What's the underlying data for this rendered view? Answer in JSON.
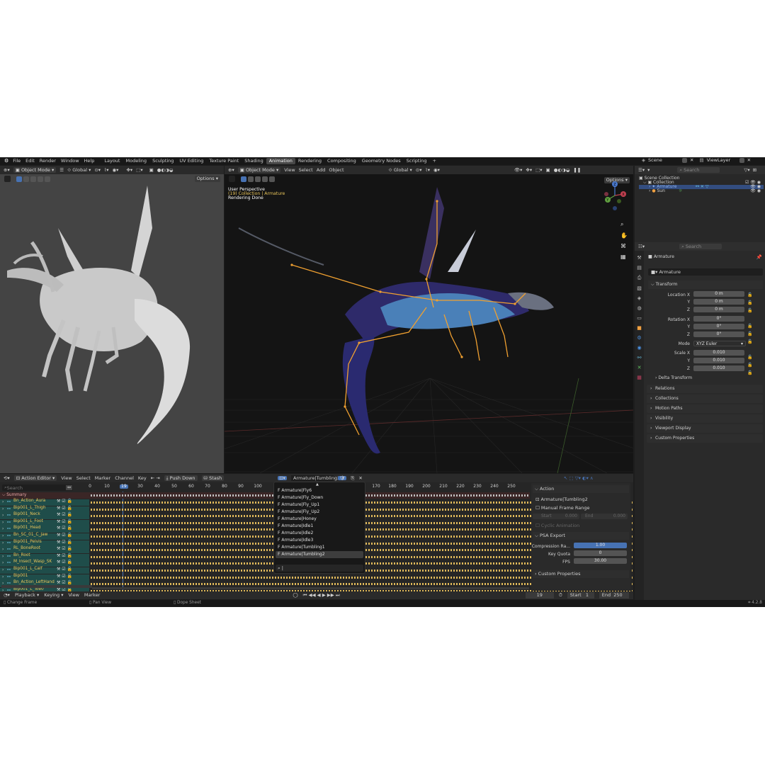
{
  "topbar": {
    "menus": [
      "File",
      "Edit",
      "Render",
      "Window",
      "Help"
    ],
    "workspaces": [
      "Layout",
      "Modeling",
      "Sculpting",
      "UV Editing",
      "Texture Paint",
      "Shading",
      "Animation",
      "Rendering",
      "Compositing",
      "Geometry Nodes",
      "Scripting"
    ],
    "active_workspace": "Animation",
    "add_tab": "+",
    "scene": "Scene",
    "view_layer": "ViewLayer"
  },
  "viewport_left": {
    "mode": "Object Mode",
    "orientation": "Global",
    "options": "Options"
  },
  "viewport_main": {
    "mode": "Object Mode",
    "menus": [
      "View",
      "Select",
      "Add",
      "Object"
    ],
    "orientation": "Global",
    "options": "Options",
    "info_line1": "User Perspective",
    "info_line2": "(19) Collection | Armature",
    "info_line3": "Rendering Done",
    "gizmo_axes": [
      "Z",
      "Y",
      "X"
    ]
  },
  "outliner": {
    "search_placeholder": "Search",
    "items": [
      {
        "label": "Scene Collection"
      },
      {
        "label": "Collection"
      },
      {
        "label": "Armature"
      },
      {
        "label": "Sun"
      }
    ]
  },
  "properties": {
    "search_placeholder": "Search",
    "object_name": "Armature",
    "name_field": "Armature",
    "transform_header": "Transform",
    "location_label": "Location X",
    "rotation_label": "Rotation X",
    "scale_label": "Scale X",
    "axis_y": "Y",
    "axis_z": "Z",
    "location": [
      "0 m",
      "0 m",
      "0 m"
    ],
    "rotation": [
      "0°",
      "0°",
      "0°"
    ],
    "mode_label": "Mode",
    "mode_value": "XYZ Euler",
    "scale": [
      "0.010",
      "0.010",
      "0.010"
    ],
    "sections": [
      "Delta Transform",
      "Relations",
      "Collections",
      "Motion Paths",
      "Visibility",
      "Viewport Display",
      "Custom Properties"
    ]
  },
  "action_editor": {
    "editor": "Action Editor",
    "menus": [
      "View",
      "Select",
      "Marker",
      "Channel",
      "Key"
    ],
    "push_down": "Push Down",
    "stash": "Stash",
    "action_name": "Armature|Tumbling2",
    "search_placeholder": "Search",
    "frame_ticks": [
      "0",
      "10",
      "19",
      "30",
      "40",
      "50",
      "60",
      "70",
      "80",
      "90",
      "100",
      "170",
      "180",
      "190",
      "200",
      "210",
      "220",
      "230",
      "240",
      "250"
    ],
    "current_frame_badge": "19",
    "summary": "Summary",
    "channels": [
      "Bn_Action_Aura",
      "Bip001_L_Thigh",
      "Bip001_Neck",
      "Bip001_L_Foot",
      "Bip001_Head",
      "Bn_SC_01_C_Jaw",
      "Bip001_Pelvis",
      "RL_BoneRoot",
      "Bn_Root",
      "M_Insect_Wasp_SK",
      "Bip001_L_Calf",
      "Bip001",
      "Bn_Action_LeftHand",
      "Bip001_L_Toe0"
    ],
    "action_list": [
      "Armature|Fly6",
      "Armature|Fly_Down",
      "Armature|Fly_Up1",
      "Armature|Fly_Up2",
      "Armature|Honey",
      "Armature|Idle1",
      "Armature|Idle2",
      "Armature|Idle3",
      "Armature|Tumbling1",
      "Armature|Tumbling2"
    ],
    "fake_user_prefix": "F"
  },
  "action_panel": {
    "header": "Action",
    "action": "Armature|Tumbling2",
    "manual_frame_range": "Manual Frame Range",
    "start_label": "Start",
    "start_value": "0.000",
    "end_label": "End",
    "end_value": "0.000",
    "cyclic": "Cyclic Animation",
    "psa_header": "PSA Export",
    "compression_label": "Compression Ra...",
    "compression_value": "1.00",
    "key_quota_label": "Key Quota",
    "key_quota_value": "0",
    "fps_label": "FPS",
    "fps_value": "30.00",
    "custom_props": "Custom Properties"
  },
  "timeline": {
    "menus": [
      "Playback",
      "Keying",
      "View",
      "Marker"
    ],
    "current_frame": "19",
    "start_label": "Start",
    "start_value": "1",
    "end_label": "End",
    "end_value": "250"
  },
  "statusbar": {
    "left": "Change Frame",
    "middle": "Pan View",
    "right_hint": "Dope Sheet",
    "version": "4.2.8"
  },
  "colors": {
    "accent_blue": "#4772b3",
    "channel_bg": "#1f4d4a",
    "keyframe": "#e0b95a",
    "bone_orange": "#f0a030",
    "summary_bg": "#5a2a2a"
  }
}
